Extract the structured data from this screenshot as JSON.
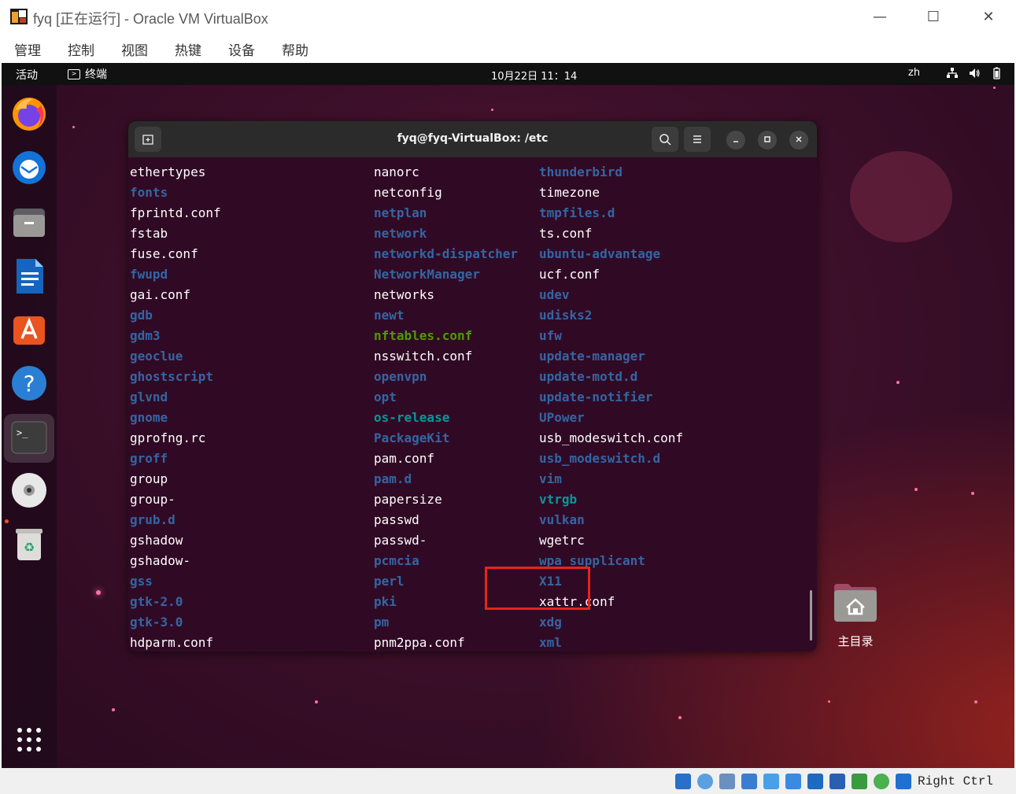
{
  "window": {
    "title": "fyq [正在运行] - Oracle VM VirtualBox",
    "minimize": "—",
    "maximize": "☐",
    "close": "✕"
  },
  "menu": [
    "管理",
    "控制",
    "视图",
    "热键",
    "设备",
    "帮助"
  ],
  "topbar": {
    "activities": "活动",
    "app": "终端",
    "clock": "10月22日  11：14",
    "lang": "zh"
  },
  "dock": {
    "items": [
      "firefox-icon",
      "thunderbird-icon",
      "files-icon",
      "writer-icon",
      "app-center-icon",
      "help-icon",
      "terminal-icon",
      "disc-icon",
      "trash-icon"
    ],
    "apps_grid": "show-apps-icon"
  },
  "terminal": {
    "title": "fyq@fyq-VirtualBox: /etc",
    "columns": [
      [
        {
          "name": "ethertypes",
          "type": "plain"
        },
        {
          "name": "fonts",
          "type": "dir"
        },
        {
          "name": "fprintd.conf",
          "type": "plain"
        },
        {
          "name": "fstab",
          "type": "plain"
        },
        {
          "name": "fuse.conf",
          "type": "plain"
        },
        {
          "name": "fwupd",
          "type": "dir"
        },
        {
          "name": "gai.conf",
          "type": "plain"
        },
        {
          "name": "gdb",
          "type": "dir"
        },
        {
          "name": "gdm3",
          "type": "dir"
        },
        {
          "name": "geoclue",
          "type": "dir"
        },
        {
          "name": "ghostscript",
          "type": "dir"
        },
        {
          "name": "glvnd",
          "type": "dir"
        },
        {
          "name": "gnome",
          "type": "dir"
        },
        {
          "name": "gprofng.rc",
          "type": "plain"
        },
        {
          "name": "groff",
          "type": "dir"
        },
        {
          "name": "group",
          "type": "plain"
        },
        {
          "name": "group-",
          "type": "plain"
        },
        {
          "name": "grub.d",
          "type": "dir"
        },
        {
          "name": "gshadow",
          "type": "plain"
        },
        {
          "name": "gshadow-",
          "type": "plain"
        },
        {
          "name": "gss",
          "type": "dir"
        },
        {
          "name": "gtk-2.0",
          "type": "dir"
        },
        {
          "name": "gtk-3.0",
          "type": "dir"
        },
        {
          "name": "hdparm.conf",
          "type": "plain"
        }
      ],
      [
        {
          "name": "nanorc",
          "type": "plain"
        },
        {
          "name": "netconfig",
          "type": "plain"
        },
        {
          "name": "netplan",
          "type": "dir"
        },
        {
          "name": "network",
          "type": "dir"
        },
        {
          "name": "networkd-dispatcher",
          "type": "dir"
        },
        {
          "name": "NetworkManager",
          "type": "dir"
        },
        {
          "name": "networks",
          "type": "plain"
        },
        {
          "name": "newt",
          "type": "dir"
        },
        {
          "name": "nftables.conf",
          "type": "exec"
        },
        {
          "name": "nsswitch.conf",
          "type": "plain"
        },
        {
          "name": "openvpn",
          "type": "dir"
        },
        {
          "name": "opt",
          "type": "dir"
        },
        {
          "name": "os-release",
          "type": "link"
        },
        {
          "name": "PackageKit",
          "type": "dir"
        },
        {
          "name": "pam.conf",
          "type": "plain"
        },
        {
          "name": "pam.d",
          "type": "dir"
        },
        {
          "name": "papersize",
          "type": "plain"
        },
        {
          "name": "passwd",
          "type": "plain"
        },
        {
          "name": "passwd-",
          "type": "plain"
        },
        {
          "name": "pcmcia",
          "type": "dir"
        },
        {
          "name": "perl",
          "type": "dir"
        },
        {
          "name": "pki",
          "type": "dir"
        },
        {
          "name": "pm",
          "type": "dir"
        },
        {
          "name": "pnm2ppa.conf",
          "type": "plain"
        }
      ],
      [
        {
          "name": "thunderbird",
          "type": "dir"
        },
        {
          "name": "timezone",
          "type": "plain"
        },
        {
          "name": "tmpfiles.d",
          "type": "dir"
        },
        {
          "name": "ts.conf",
          "type": "plain"
        },
        {
          "name": "ubuntu-advantage",
          "type": "dir"
        },
        {
          "name": "ucf.conf",
          "type": "plain"
        },
        {
          "name": "udev",
          "type": "dir"
        },
        {
          "name": "udisks2",
          "type": "dir"
        },
        {
          "name": "ufw",
          "type": "dir"
        },
        {
          "name": "update-manager",
          "type": "dir"
        },
        {
          "name": "update-motd.d",
          "type": "dir"
        },
        {
          "name": "update-notifier",
          "type": "dir"
        },
        {
          "name": "UPower",
          "type": "dir"
        },
        {
          "name": "usb_modeswitch.conf",
          "type": "plain"
        },
        {
          "name": "usb_modeswitch.d",
          "type": "dir"
        },
        {
          "name": "vim",
          "type": "dir"
        },
        {
          "name": "vtrgb",
          "type": "link"
        },
        {
          "name": "vulkan",
          "type": "dir"
        },
        {
          "name": "wgetrc",
          "type": "plain"
        },
        {
          "name": "wpa_supplicant",
          "type": "dir"
        },
        {
          "name": "X11",
          "type": "dir"
        },
        {
          "name": "xattr.conf",
          "type": "plain"
        },
        {
          "name": "xdg",
          "type": "dir"
        },
        {
          "name": "xml",
          "type": "dir"
        }
      ]
    ],
    "highlighted": [
      "passwd",
      "passwd-"
    ],
    "highlight_color": "#e8231c"
  },
  "desktop": {
    "home_label": "主目录"
  },
  "statusbar": {
    "host_key": "Right Ctrl"
  },
  "colors": {
    "dir": "#3465a4",
    "exec": "#4e9a06",
    "link": "#06989a",
    "terminal_bg": "#300a24"
  }
}
